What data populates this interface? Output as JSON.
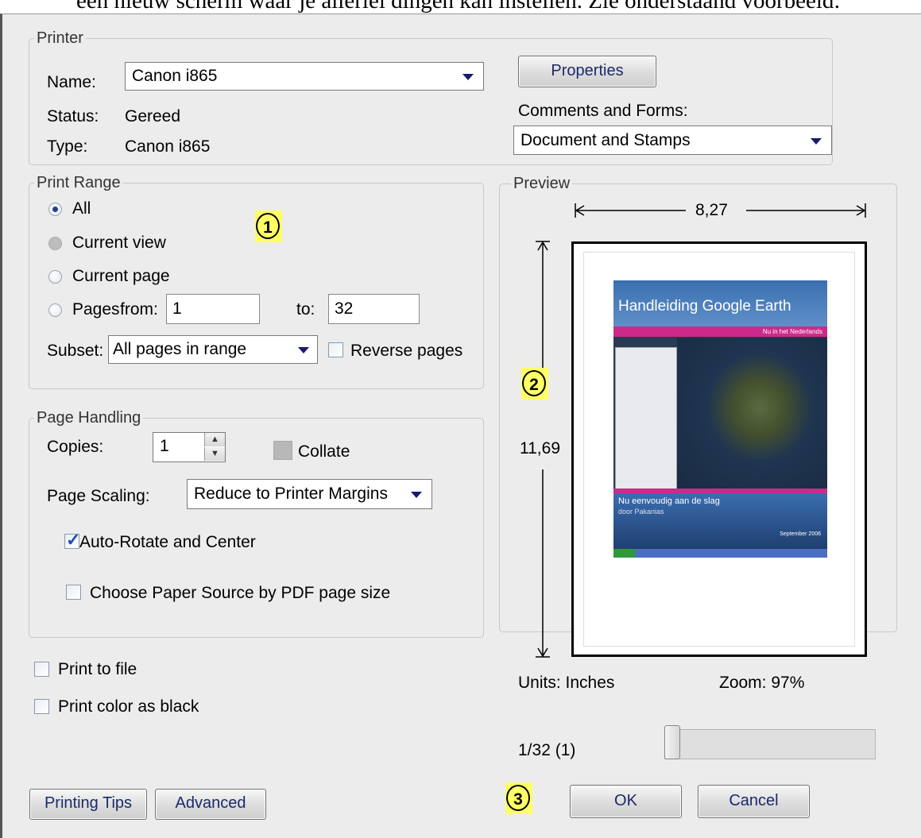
{
  "top_text": "een nieuw scherm waar je allerlei dingen kan instellen. Zie onderstaand voorbeeld:",
  "printer": {
    "group_label": "Printer",
    "name_label": "Name:",
    "name_value": "Canon i865",
    "status_label": "Status:",
    "status_value": "Gereed",
    "type_label": "Type:",
    "type_value": "Canon i865",
    "properties_button": "Properties",
    "comments_label": "Comments and Forms:",
    "comments_value": "Document and Stamps"
  },
  "print_range": {
    "group_label": "Print Range",
    "all": "All",
    "current_view": "Current view",
    "current_page": "Current page",
    "pages": "Pages",
    "from_label": "from:",
    "from_value": "1",
    "to_label": "to:",
    "to_value": "32",
    "subset_label": "Subset:",
    "subset_value": "All pages in range",
    "reverse_pages": "Reverse pages"
  },
  "page_handling": {
    "group_label": "Page Handling",
    "copies_label": "Copies:",
    "copies_value": "1",
    "collate": "Collate",
    "scaling_label": "Page Scaling:",
    "scaling_value": "Reduce to Printer Margins",
    "auto_rotate": "Auto-Rotate and Center",
    "auto_rotate_checked": true,
    "paper_source": "Choose Paper Source by PDF page size"
  },
  "options": {
    "print_to_file": "Print to file",
    "print_color_black": "Print color as black"
  },
  "preview": {
    "group_label": "Preview",
    "width": "8,27",
    "height": "11,69",
    "units": "Units: Inches",
    "zoom": "Zoom:  97%",
    "page_indicator": "1/32 (1)",
    "slider_position": 0.0,
    "doc_title": "Handleiding Google Earth",
    "doc_subtitle": "Nu in het Nederlands",
    "doc_footer_1": "Nu eenvoudig aan de slag",
    "doc_footer_2": "door Pakanias",
    "doc_date": "September 2006"
  },
  "buttons": {
    "printing_tips": "Printing Tips",
    "advanced": "Advanced",
    "ok": "OK",
    "cancel": "Cancel"
  },
  "callouts": [
    "1",
    "2",
    "3"
  ]
}
